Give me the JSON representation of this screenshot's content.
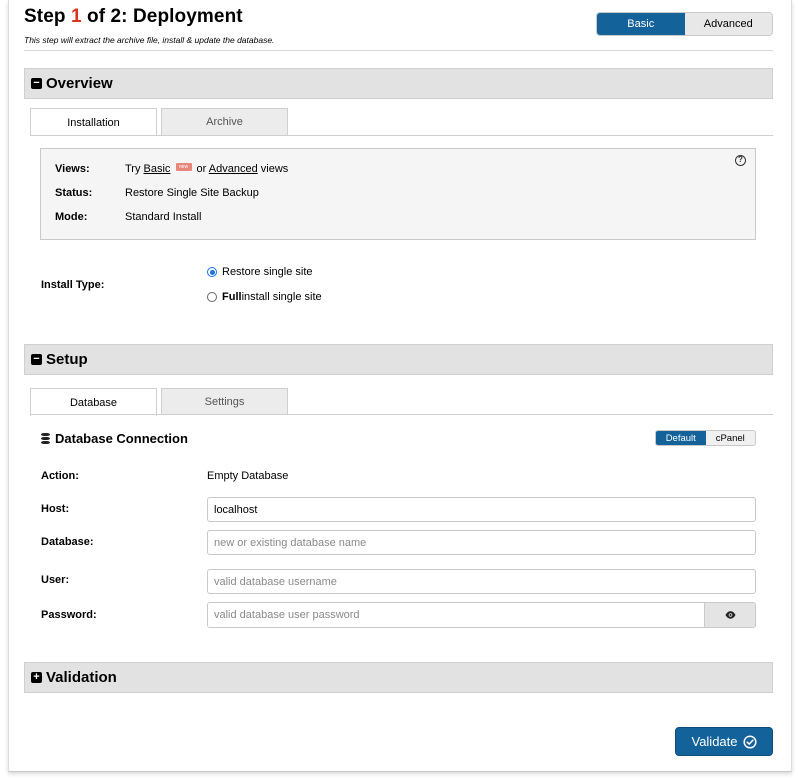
{
  "header": {
    "title_prefix": "Step ",
    "step_number": "1",
    "title_suffix": " of 2: Deployment",
    "subtitle": "This step will extract the archive file, install & update the database."
  },
  "view_toggle": {
    "basic": "Basic",
    "advanced": "Advanced",
    "active": "Basic"
  },
  "overview": {
    "title": "Overview",
    "toggle_icon": "minus-square-icon",
    "tabs": [
      {
        "label": "Installation",
        "active": true
      },
      {
        "label": "Archive",
        "active": false
      }
    ],
    "info": {
      "views_label": "Views:",
      "views_try": "Try ",
      "views_basic": "Basic",
      "views_badge": "new",
      "views_or": " or ",
      "views_advanced": "Advanced",
      "views_tail": " views",
      "status_label": "Status:",
      "status_value": "Restore Single Site Backup",
      "mode_label": "Mode:",
      "mode_value": "Standard Install",
      "help_icon": "question-circle-icon"
    },
    "install_type": {
      "label": "Install Type:",
      "options": [
        {
          "label": "Restore single site",
          "checked": true
        },
        {
          "bold": "Full",
          "rest": " install single site",
          "checked": false
        }
      ]
    }
  },
  "setup": {
    "title": "Setup",
    "toggle_icon": "minus-square-icon",
    "tabs": [
      {
        "label": "Database",
        "active": true
      },
      {
        "label": "Settings",
        "active": false
      }
    ],
    "db_connection": {
      "title": "Database Connection",
      "icon": "database-icon",
      "mode_default": "Default",
      "mode_cpanel": "cPanel",
      "action_label": "Action:",
      "action_value": "Empty Database",
      "host_label": "Host:",
      "host_value": "localhost",
      "database_label": "Database:",
      "database_placeholder": "new or existing database name",
      "user_label": "User:",
      "user_placeholder": "valid database username",
      "password_label": "Password:",
      "password_placeholder": "valid database user password",
      "eye_icon": "eye-icon"
    }
  },
  "validation": {
    "title": "Validation",
    "toggle_icon": "plus-square-icon"
  },
  "footer": {
    "validate_label": "Validate",
    "validate_icon": "check-circle-icon"
  },
  "colors": {
    "accent": "#13629a",
    "step_number": "#d8341f",
    "section_bar": "#e2e2e2"
  }
}
